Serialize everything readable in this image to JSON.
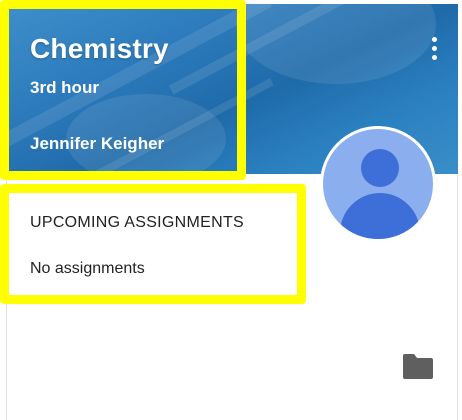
{
  "class_card": {
    "title": "Chemistry",
    "section": "3rd hour",
    "teacher": "Jennifer Keigher",
    "menu_icon": "more-vert-icon",
    "avatar_icon": "person-avatar-icon"
  },
  "upcoming": {
    "heading": "UPCOMING ASSIGNMENTS",
    "empty_text": "No assignments"
  },
  "footer": {
    "folder_icon": "folder-icon"
  },
  "colors": {
    "banner": "#2d7bbc",
    "highlight": "#ffff00",
    "avatar_bg": "#8aaeee",
    "avatar_fg": "#3e6fd8"
  }
}
